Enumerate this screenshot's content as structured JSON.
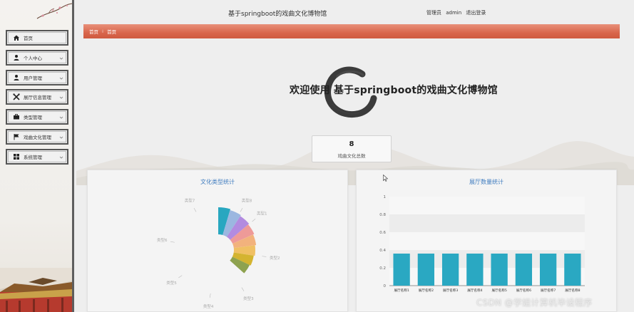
{
  "header": {
    "title": "基于springboot的戏曲文化博物馆",
    "role": "管理员",
    "username": "admin",
    "logout": "退出登录"
  },
  "sidebar": {
    "items": [
      {
        "label": "首页",
        "icon": "home-icon",
        "chevron": false
      },
      {
        "label": "个人中心",
        "icon": "user-icon",
        "chevron": true
      },
      {
        "label": "用户管理",
        "icon": "user-icon",
        "chevron": true
      },
      {
        "label": "展厅信息管理",
        "icon": "crossed-swords-icon",
        "chevron": true
      },
      {
        "label": "类型管理",
        "icon": "briefcase-icon",
        "chevron": true
      },
      {
        "label": "戏曲文化管理",
        "icon": "flag-icon",
        "chevron": true
      },
      {
        "label": "系统管理",
        "icon": "grid-icon",
        "chevron": true
      }
    ]
  },
  "breadcrumb": {
    "home": "首页",
    "current": "首页"
  },
  "welcome": {
    "text": "欢迎使用 基于springboot的戏曲文化博物馆"
  },
  "stat": {
    "value": "8",
    "label": "戏曲文化总数"
  },
  "watermark": "CSDN @学姐计算机毕设程序",
  "colors": {
    "accent": "#d9664c",
    "bar": "#2aa8c2",
    "title": "#3f7cbf"
  },
  "chart_data": [
    {
      "type": "pie",
      "title": "文化类型统计",
      "categories": [
        "类型1",
        "类型2",
        "类型3",
        "类型4",
        "类型5",
        "类型6",
        "类型7",
        "类型8"
      ],
      "colors": [
        "#28a7c0",
        "#9bb7e0",
        "#b28be0",
        "#ee9a98",
        "#f2b27d",
        "#f0c064",
        "#d4b430",
        "#8ea24f"
      ]
    },
    {
      "type": "bar",
      "title": "展厅数量统计",
      "categories": [
        "展厅名称1",
        "展厅名称2",
        "展厅名称3",
        "展厅名称4",
        "展厅名称5",
        "展厅名称6",
        "展厅名称7",
        "展厅名称8"
      ],
      "values": [
        0.36,
        0.36,
        0.36,
        0.36,
        0.36,
        0.36,
        0.36,
        0.36
      ],
      "ylim": [
        0,
        1
      ],
      "yticks": [
        "0",
        "0.2",
        "0.4",
        "0.6",
        "0.8",
        "1"
      ]
    }
  ]
}
